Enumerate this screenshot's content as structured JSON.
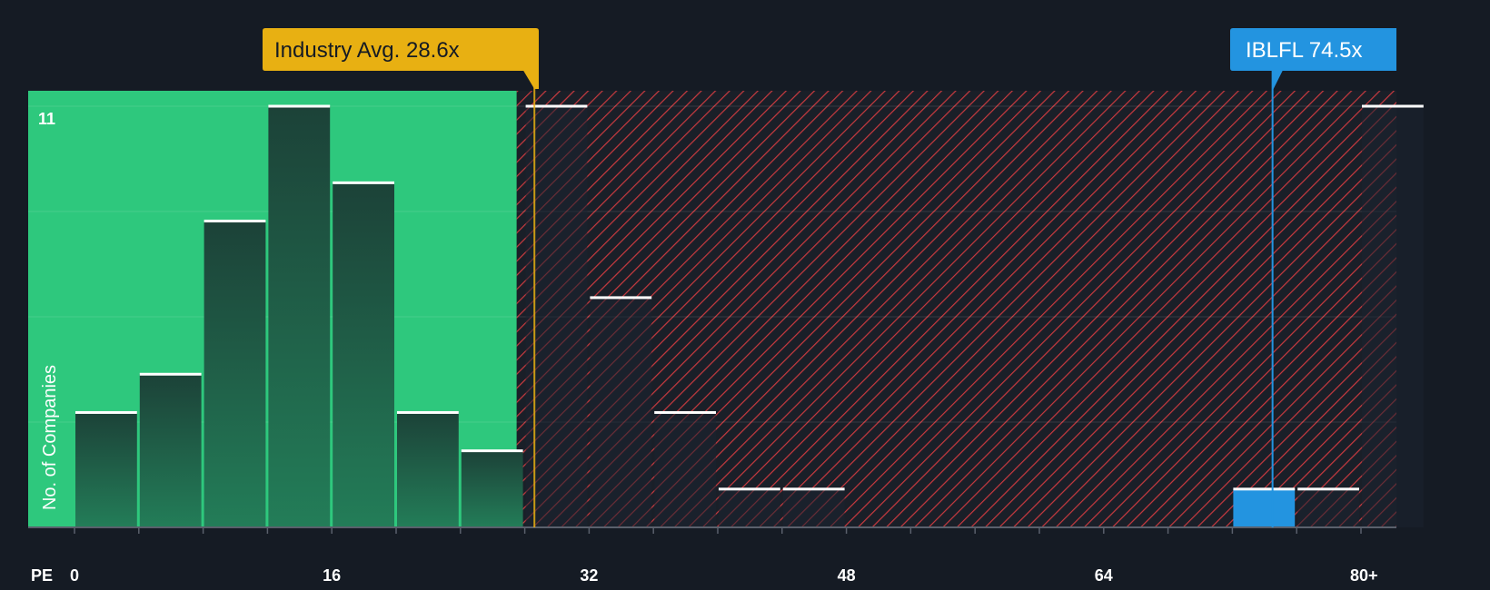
{
  "chart_data": {
    "type": "bar",
    "x_label": "PE",
    "ylabel": "No. of Companies",
    "x_ticks": [
      {
        "value": 0,
        "label": "0"
      },
      {
        "value": 16,
        "label": "16"
      },
      {
        "value": 32,
        "label": "32"
      },
      {
        "value": 48,
        "label": "48"
      },
      {
        "value": 64,
        "label": "64"
      },
      {
        "value": 80,
        "label": "80+"
      }
    ],
    "y_max_label": "11",
    "ylim": [
      0,
      11
    ],
    "bin_width": 4,
    "bins": [
      {
        "x0": 0,
        "value": 3
      },
      {
        "x0": 4,
        "value": 4
      },
      {
        "x0": 8,
        "value": 8
      },
      {
        "x0": 12,
        "value": 11
      },
      {
        "x0": 16,
        "value": 9
      },
      {
        "x0": 20,
        "value": 3
      },
      {
        "x0": 24,
        "value": 2
      },
      {
        "x0": 28,
        "value": 11
      },
      {
        "x0": 32,
        "value": 6
      },
      {
        "x0": 36,
        "value": 3
      },
      {
        "x0": 40,
        "value": 1
      },
      {
        "x0": 44,
        "value": 1
      },
      {
        "x0": 48,
        "value": 0
      },
      {
        "x0": 52,
        "value": 0
      },
      {
        "x0": 56,
        "value": 0
      },
      {
        "x0": 60,
        "value": 0
      },
      {
        "x0": 64,
        "value": 0
      },
      {
        "x0": 68,
        "value": 0
      },
      {
        "x0": 72,
        "value": 1,
        "highlight": true
      },
      {
        "x0": 76,
        "value": 1
      },
      {
        "x0": 80,
        "value": 11
      }
    ],
    "fair_range_max": 27.5,
    "industry_avg": {
      "label": "Industry Avg. 28.6x",
      "value": 28.6
    },
    "company": {
      "label": "IBLFL 74.5x",
      "value": 74.5
    },
    "colors": {
      "background": "#151b24",
      "fair_zone": "#2ec87d",
      "bar_fair": "#1e4a3d",
      "bar_over": "#1c2330",
      "hatch": "#c93a3f",
      "industry": "#e8b012",
      "company": "#2394e0",
      "cap": "#ffffff"
    }
  }
}
